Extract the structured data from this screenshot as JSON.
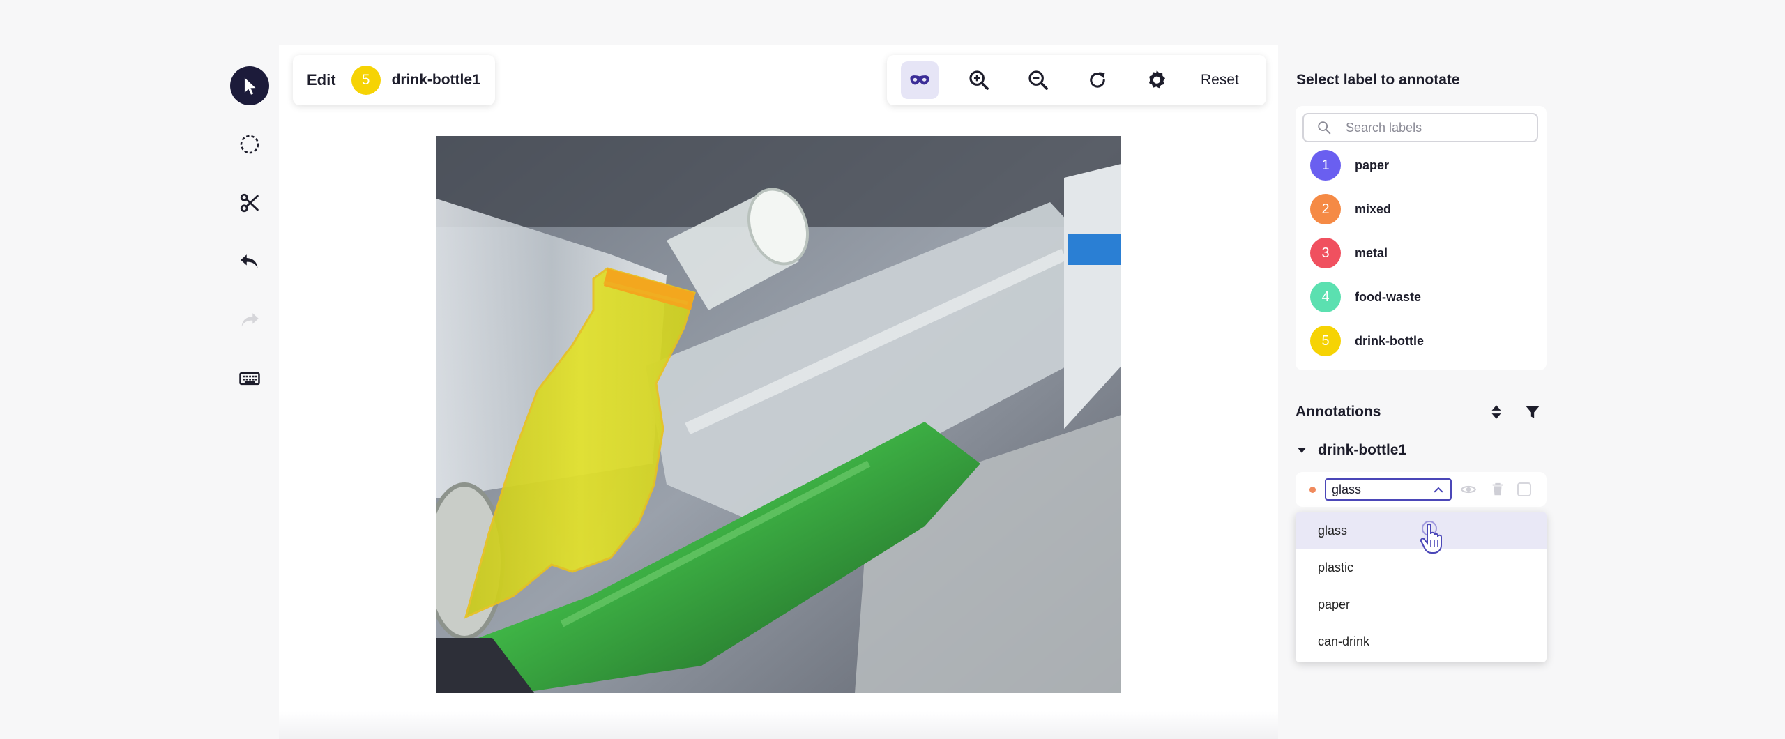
{
  "toolbar": {
    "tools": [
      "pointer-icon",
      "lasso-icon",
      "scissors-icon",
      "undo-icon",
      "redo-icon",
      "keyboard-icon"
    ]
  },
  "edit_card": {
    "mode": "Edit",
    "badge": "5",
    "annotation_name": "drink-bottle1",
    "badge_color": "#f6d304"
  },
  "view_toolbar": {
    "icons": [
      "mask-icon",
      "zoom-in-icon",
      "zoom-out-icon",
      "rotate-icon",
      "brightness-icon"
    ],
    "reset_label": "Reset"
  },
  "right_panel": {
    "title": "Select label to annotate",
    "search_placeholder": "Search labels",
    "labels": [
      {
        "number": "1",
        "name": "paper",
        "color": "#6a5ff0"
      },
      {
        "number": "2",
        "name": "mixed",
        "color": "#f58a45"
      },
      {
        "number": "3",
        "name": "metal",
        "color": "#f0505f"
      },
      {
        "number": "4",
        "name": "food-waste",
        "color": "#5be0b0"
      },
      {
        "number": "5",
        "name": "drink-bottle",
        "color": "#f6d304"
      }
    ],
    "annotations_title": "Annotations",
    "group_name": "drink-bottle1",
    "attribute_value": "glass",
    "options": [
      "glass",
      "plastic",
      "paper",
      "can-drink"
    ]
  },
  "colors": {
    "accent": "#1c1b3a",
    "select_border": "#4b47b8",
    "highlight": "#e9e8f6"
  }
}
